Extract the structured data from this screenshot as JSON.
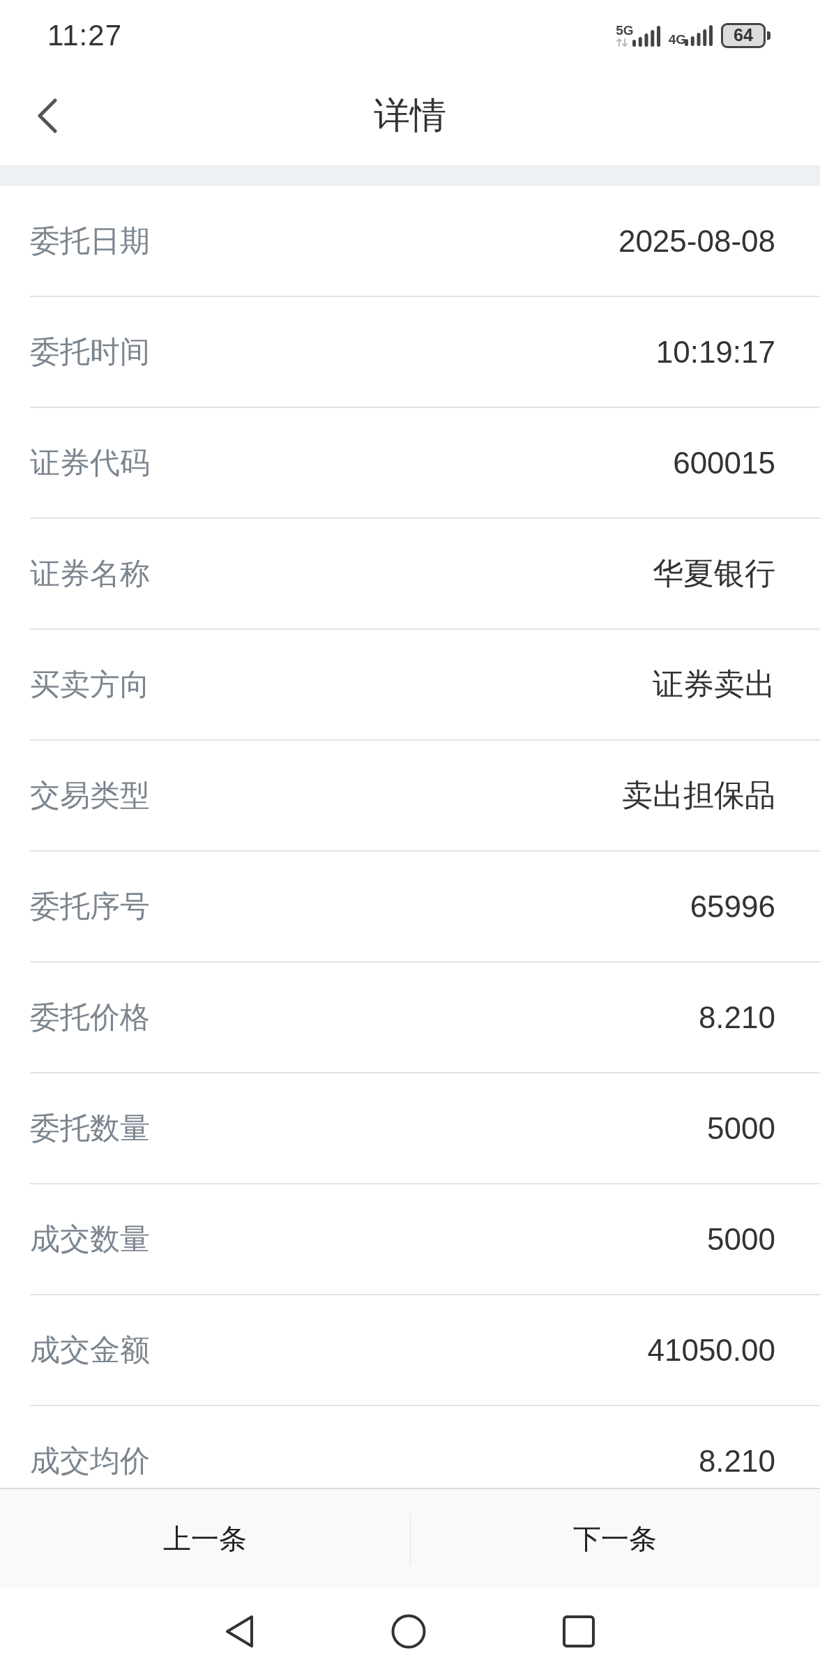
{
  "status_bar": {
    "time": "11:27",
    "networks": [
      {
        "label": "5G",
        "data_active": true
      },
      {
        "label": "4G",
        "data_active": false
      }
    ],
    "battery": "64"
  },
  "header": {
    "title": "详情"
  },
  "details": [
    {
      "label": "委托日期",
      "value": "2025-08-08"
    },
    {
      "label": "委托时间",
      "value": "10:19:17"
    },
    {
      "label": "证券代码",
      "value": "600015"
    },
    {
      "label": "证券名称",
      "value": "华夏银行"
    },
    {
      "label": "买卖方向",
      "value": "证券卖出"
    },
    {
      "label": "交易类型",
      "value": "卖出担保品"
    },
    {
      "label": "委托序号",
      "value": "65996"
    },
    {
      "label": "委托价格",
      "value": "8.210"
    },
    {
      "label": "委托数量",
      "value": "5000"
    },
    {
      "label": "成交数量",
      "value": "5000"
    },
    {
      "label": "成交金额",
      "value": "41050.00"
    },
    {
      "label": "成交均价",
      "value": "8.210"
    }
  ],
  "footer": {
    "buttons": [
      "上一条",
      "下一条"
    ]
  }
}
